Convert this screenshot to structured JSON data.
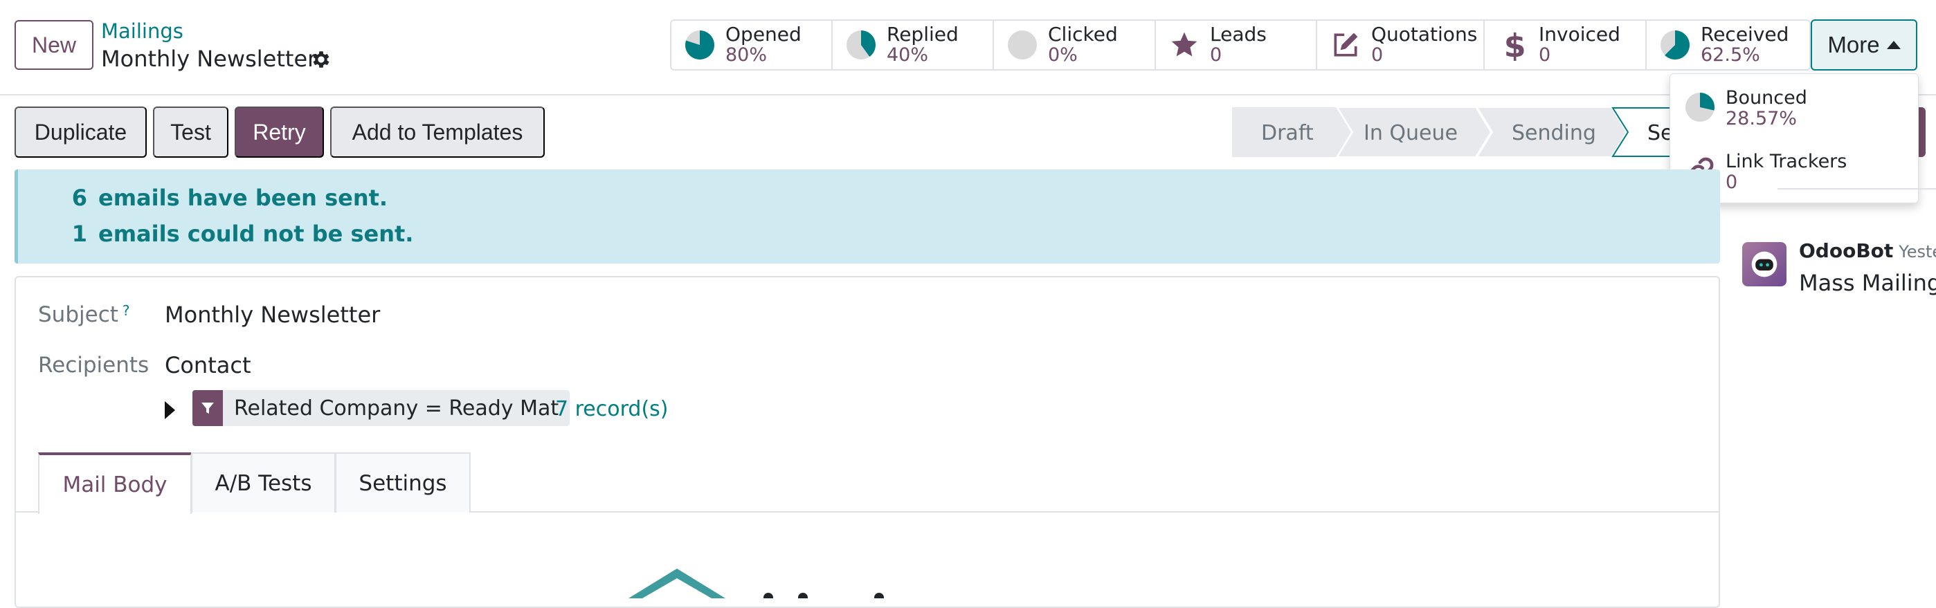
{
  "control_panel": {
    "new_label": "New",
    "breadcrumb_parent": "Mailings",
    "breadcrumb_current": "Monthly Newsletter"
  },
  "stats": [
    {
      "label": "Opened",
      "value": "80%",
      "fraction": 0.8,
      "icon": "pie-chart-icon"
    },
    {
      "label": "Replied",
      "value": "40%",
      "fraction": 0.4,
      "icon": "pie-chart-icon"
    },
    {
      "label": "Clicked",
      "value": "0%",
      "fraction": 0,
      "icon": "pie-chart-icon"
    },
    {
      "label": "Leads",
      "value": "0",
      "icon": "star-icon"
    },
    {
      "label": "Quotations",
      "value": "0",
      "icon": "pencil-square-icon"
    },
    {
      "label": "Invoiced",
      "value": "0",
      "icon": "dollar-icon"
    },
    {
      "label": "Received",
      "value": "62.5%",
      "fraction": 0.625,
      "icon": "pie-chart-icon"
    }
  ],
  "more": {
    "label": "More",
    "items": [
      {
        "label": "Bounced",
        "value": "28.57%",
        "fraction": 0.2857,
        "icon": "pie-chart-icon"
      },
      {
        "label": "Link Trackers",
        "value": "0",
        "icon": "link-icon"
      }
    ]
  },
  "actions": {
    "duplicate": "Duplicate",
    "test": "Test",
    "retry": "Retry",
    "add_to_templates": "Add to Templates"
  },
  "status": {
    "stages": [
      "Draft",
      "In Queue",
      "Sending",
      "Se"
    ],
    "active_index": 3
  },
  "alert": {
    "sent_count": "6",
    "sent_text": "emails have been sent.",
    "failed_count": "1",
    "failed_text": "emails could not be sent."
  },
  "form": {
    "subject_label": "Subject",
    "subject_help": "?",
    "subject_value": "Monthly Newsletter",
    "recipients_label": "Recipients",
    "recipients_value": "Contact",
    "domain_filter": "Related Company = Ready Mat",
    "records_link": "7 record(s)"
  },
  "tabs": [
    "Mail Body",
    "A/B Tests",
    "Settings"
  ],
  "chatter": {
    "author": "OdooBot",
    "timestamp": "Yesterd",
    "message": "Mass Mailing"
  },
  "colors": {
    "primary": "#714b67",
    "teal": "#017e84",
    "alert_bg": "#cfeaf0",
    "pie_fill": "#017e84",
    "pie_empty": "#d9d9d9"
  }
}
